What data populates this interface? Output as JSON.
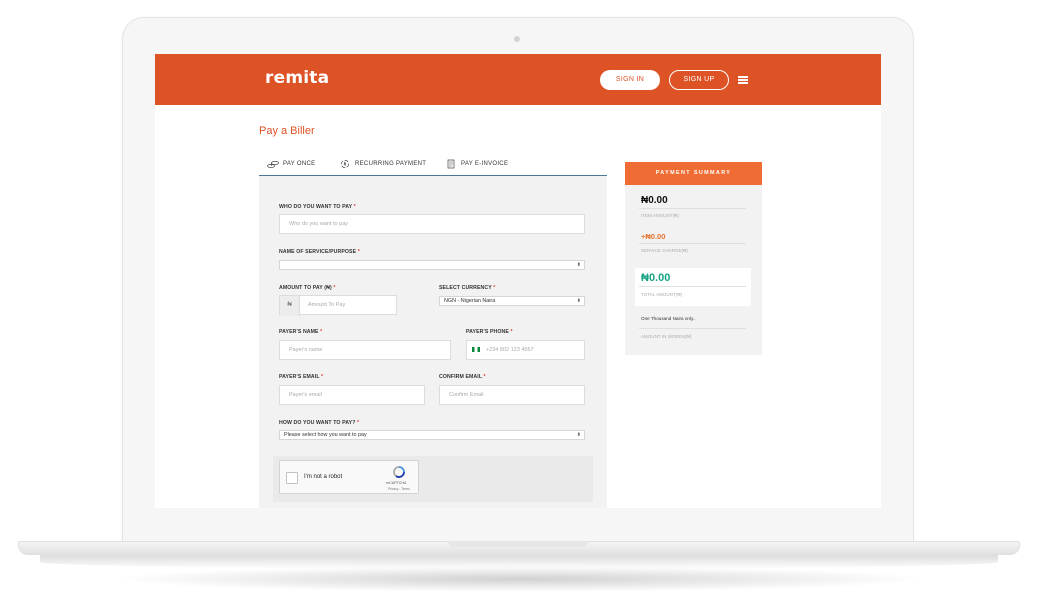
{
  "header": {
    "logo_text": "remita",
    "signin_label": "SIGN IN",
    "signup_label": "SIGN UP"
  },
  "page": {
    "title": "Pay a Biller"
  },
  "tabs": [
    {
      "label": "PAY ONCE",
      "icon": "coins-icon"
    },
    {
      "label": "RECURRING PAYMENT",
      "icon": "recurring-icon"
    },
    {
      "label": "PAY E-INVOICE",
      "icon": "invoice-icon"
    }
  ],
  "form": {
    "who_label": "WHO DO YOU WANT TO PAY",
    "who_placeholder": "Who do you want to pay",
    "service_label": "NAME OF SERVICE/PURPOSE",
    "service_value": "",
    "amount_label": "AMOUNT TO PAY (₦)",
    "amount_prefix": "₦",
    "amount_placeholder": "Amount To Pay",
    "currency_label": "SELECT CURRENCY",
    "currency_value": "NGN - Nigerian Naira",
    "payer_name_label": "PAYER'S NAME",
    "payer_name_placeholder": "Payer's name",
    "payer_phone_label": "PAYER'S PHONE",
    "payer_phone_placeholder": "+234 802 123 4567",
    "payer_email_label": "PAYER'S EMAIL",
    "payer_email_placeholder": "Payer's email",
    "confirm_email_label": "CONFIRM EMAIL",
    "confirm_email_placeholder": "Confirm Email",
    "method_label": "HOW DO YOU WANT TO PAY?",
    "method_value": "Please select how you want to pay",
    "required_mark": "*"
  },
  "captcha": {
    "text": "I'm not a robot",
    "brand": "reCAPTCHA",
    "terms": "Privacy - Terms"
  },
  "summary": {
    "title": "PAYMENT SUMMARY",
    "item_amount": "₦0.00",
    "item_caption": "ITEM AMOUNT(₦)",
    "service_charge": "+₦0.00",
    "service_caption": "SERVICE CHARGE(₦)",
    "total_amount": "₦0.00",
    "total_caption": "TOTAL AMOUNT(₦)",
    "words": "One Thousand Naira only..",
    "words_caption": "AMOUNT IN WORDS(₦)"
  },
  "colors": {
    "brand": "#de5326",
    "summary_header": "#ef6d35",
    "total_green": "#15a386",
    "service_orange": "#e6732e"
  }
}
